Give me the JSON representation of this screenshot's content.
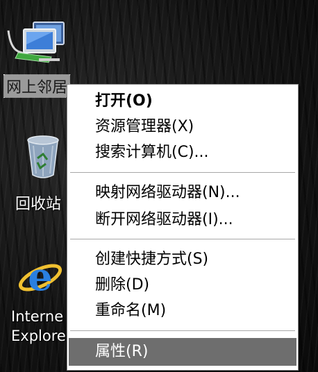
{
  "desktop": {
    "icons": [
      {
        "label": "网上邻居",
        "icon": "network-icon"
      },
      {
        "label": "回收站",
        "icon": "recycle-bin-icon"
      },
      {
        "label_line1": "Interne",
        "label_line2": "Explore",
        "icon": "internet-explorer-icon"
      }
    ]
  },
  "context_menu": {
    "items": [
      {
        "label": "打开(O)",
        "bold": true
      },
      {
        "label": "资源管理器(X)"
      },
      {
        "label": "搜索计算机(C)..."
      },
      {
        "label": "映射网络驱动器(N)..."
      },
      {
        "label": "断开网络驱动器(I)..."
      },
      {
        "label": "创建快捷方式(S)"
      },
      {
        "label": "删除(D)"
      },
      {
        "label": "重命名(M)"
      },
      {
        "label": "属性(R)",
        "highlighted": true
      }
    ]
  },
  "colors": {
    "menu_background": "#ffffff",
    "menu_highlight": "#6e6e6e",
    "selection_background": "#9a9a9a"
  }
}
